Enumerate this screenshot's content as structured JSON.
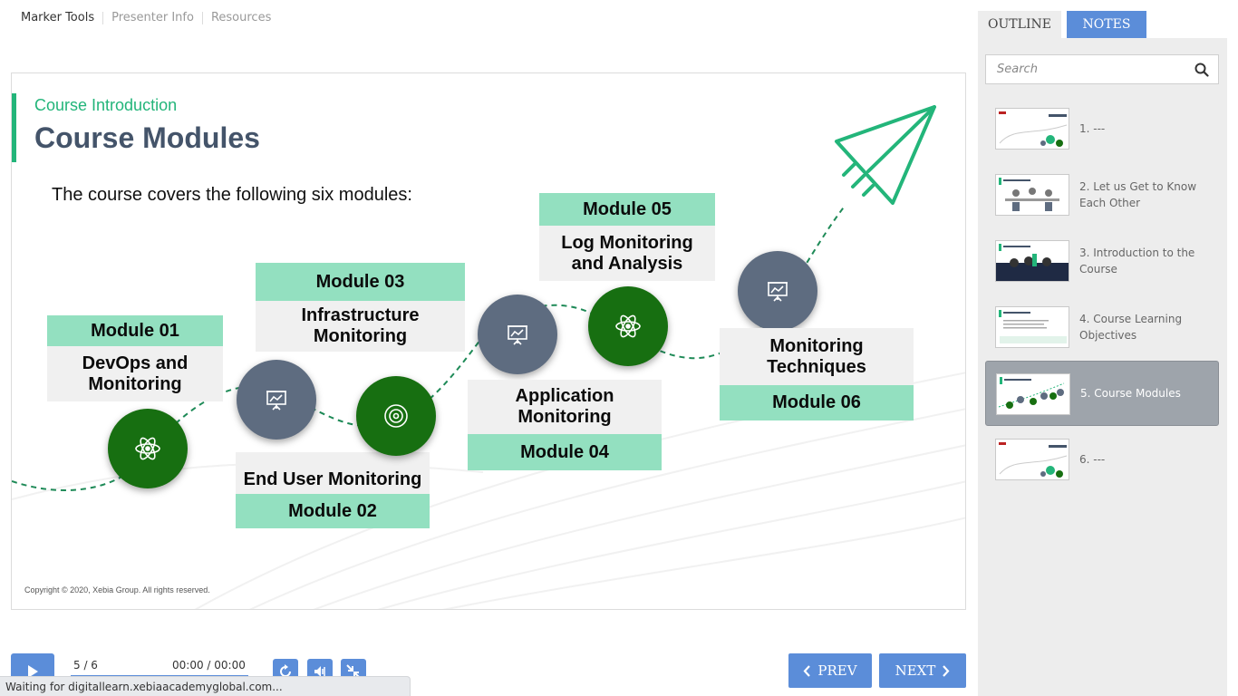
{
  "top_tabs": [
    "Marker Tools",
    "Presenter Info",
    "Resources"
  ],
  "slide": {
    "subtitle": "Course Introduction",
    "title": "Course Modules",
    "intro": "The course covers the following six modules:",
    "modules": [
      {
        "label": "Module 01",
        "desc": "DevOps and Monitoring"
      },
      {
        "label": "Module 02",
        "desc": "End User Monitoring"
      },
      {
        "label": "Module 03",
        "desc": "Infrastructure Monitoring"
      },
      {
        "label": "Module 04",
        "desc": "Application Monitoring"
      },
      {
        "label": "Module 05",
        "desc": "Log Monitoring and Analysis"
      },
      {
        "label": "Module 06",
        "desc": "Monitoring Techniques"
      }
    ],
    "copyright": "Copyright © 2020, Xebia Group. All rights reserved."
  },
  "sidebar": {
    "tabs": {
      "outline": "OUTLINE",
      "notes": "NOTES"
    },
    "search_placeholder": "Search",
    "items": [
      {
        "label": "1. ---"
      },
      {
        "label": "2. Let us Get to Know Each Other"
      },
      {
        "label": "3. Introduction to the Course"
      },
      {
        "label": "4. Course Learning Objectives"
      },
      {
        "label": "5. Course Modules",
        "active": true
      },
      {
        "label": "6. ---"
      }
    ]
  },
  "player": {
    "slide_count": "5 / 6",
    "time": "00:00 / 00:00",
    "prev_label": "PREV",
    "next_label": "NEXT",
    "status_text": "Waiting for digitallearn.xebiaacademyglobal.com..."
  },
  "colors": {
    "accent_blue": "#5b8dd9",
    "brand_green": "#23b57a",
    "module_green": "#93e0c0",
    "circle_green": "#176f11",
    "circle_slate": "#5e6c80"
  }
}
